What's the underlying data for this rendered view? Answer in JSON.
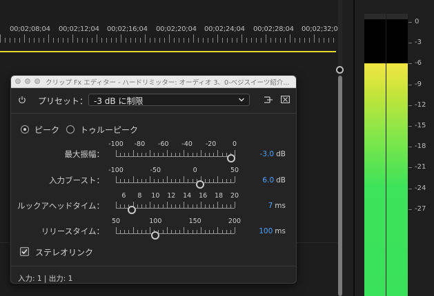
{
  "timeline": {
    "timecodes": [
      "00;02;08;04",
      "00;02;12;04",
      "00;02;16;04",
      "00;02;20;04",
      "00;02;24;04",
      "00;02;28;04",
      "00;02;32;0"
    ]
  },
  "meter": {
    "labels": [
      "0",
      "-3",
      "-6",
      "-9",
      "-12",
      "-15",
      "-18",
      "-21",
      "-24",
      "-27"
    ],
    "level_db": -6
  },
  "dialog": {
    "title": "クリップ Fx エディター - ハードリミッター: オーディオ 3、0-べジスイーツ紹介...",
    "preset_label": "プリセット：",
    "preset_value": "-3 dB に制限",
    "modes": [
      {
        "label": "ピーク",
        "selected": true
      },
      {
        "label": "トゥルーピーク",
        "selected": false
      }
    ],
    "sliders": [
      {
        "label": "最大振幅：",
        "scale": [
          "-100",
          "-80",
          "-60",
          "-40",
          "-20",
          "0"
        ],
        "min": -100,
        "max": 0,
        "value": -3.0,
        "value_text": "-3.0",
        "unit": "dB"
      },
      {
        "label": "入力ブースト：",
        "scale": [
          "-100",
          "-50",
          "0",
          "50"
        ],
        "min": -100,
        "max": 50,
        "value": 6.0,
        "value_text": "6.0",
        "unit": "dB"
      },
      {
        "label": "ルックアヘッドタイム：",
        "scale": [
          "6",
          "8",
          "10",
          "12",
          "14",
          "16",
          "18",
          "20"
        ],
        "min": 5,
        "max": 20,
        "value": 7,
        "value_text": "7",
        "unit": "ms"
      },
      {
        "label": "リリースタイム：",
        "scale": [
          "50",
          "100",
          "150",
          "200"
        ],
        "min": 50,
        "max": 200,
        "value": 100,
        "value_text": "100",
        "unit": "ms"
      }
    ],
    "stereo_link_label": "ステレオリンク",
    "stereo_link_checked": true,
    "io_label": "入力: 1 | 出力: 1"
  },
  "colors": {
    "accent_value": "#4aa3ff",
    "playhead": "#e6d92a",
    "meter_yellow": "#f3e542",
    "meter_green": "#39e05a"
  }
}
